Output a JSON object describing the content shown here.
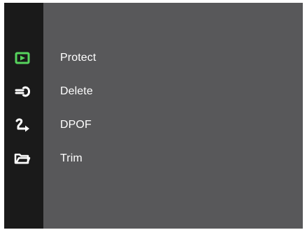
{
  "menu": {
    "items": [
      {
        "label": "Protect",
        "icon": "playback-icon",
        "selected": true
      },
      {
        "label": "Delete",
        "icon": "wrench-icon",
        "selected": false
      },
      {
        "label": "DPOF",
        "icon": "connection-arrow-icon",
        "selected": false
      },
      {
        "label": "Trim",
        "icon": "folder-icon",
        "selected": false
      }
    ]
  },
  "colors": {
    "screen_background": "#58585a",
    "sidebar_background": "#1a1a1a",
    "selected_icon": "#56d35d",
    "icon": "#ffffff",
    "text": "#ffffff"
  }
}
